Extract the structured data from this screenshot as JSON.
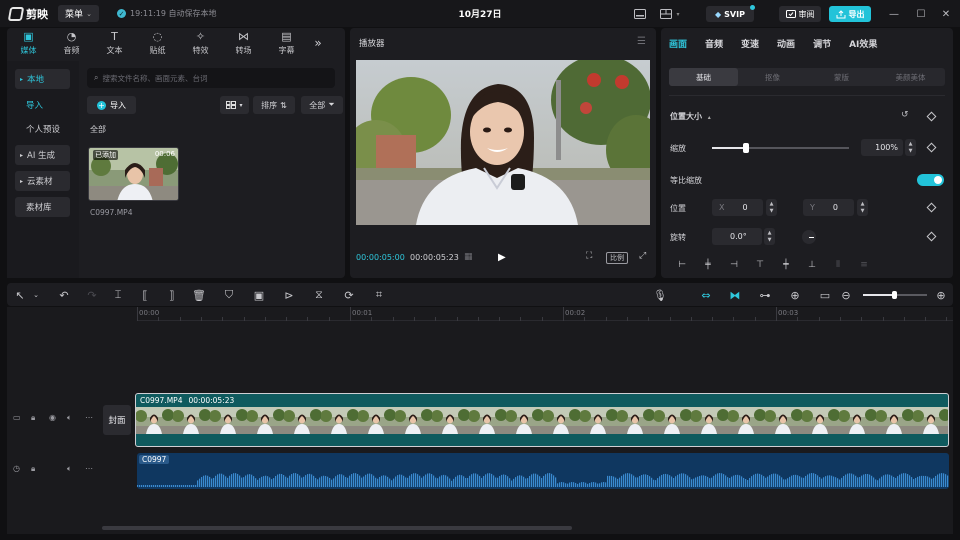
{
  "titlebar": {
    "app_name": "剪映",
    "menu_label": "菜单",
    "save_status": "19:11:19 自动保存本地",
    "project_title": "10月27日",
    "svip_label": "SVIP",
    "review_label": "审阅",
    "export_label": "导出"
  },
  "media_panel": {
    "tabs": [
      {
        "label": "媒体",
        "icon": "media-icon",
        "active": true
      },
      {
        "label": "音频",
        "icon": "audio-icon"
      },
      {
        "label": "文本",
        "icon": "text-icon"
      },
      {
        "label": "贴纸",
        "icon": "sticker-icon"
      },
      {
        "label": "特效",
        "icon": "effects-icon"
      },
      {
        "label": "转场",
        "icon": "transition-icon"
      },
      {
        "label": "字幕",
        "icon": "subtitle-icon"
      }
    ],
    "side_nav": [
      {
        "label": "本地",
        "active": true,
        "boxed": true,
        "arrow": true
      },
      {
        "label": "导入",
        "active": true
      },
      {
        "label": "个人预设"
      },
      {
        "label": "AI 生成",
        "boxed": true,
        "arrow": true
      },
      {
        "label": "云素材",
        "boxed": true,
        "arrow": true
      },
      {
        "label": "素材库",
        "boxed": true
      }
    ],
    "search_placeholder": "搜索文件名称、画面元素、台词",
    "import_label": "导入",
    "sort_label": "排序",
    "filter_label": "全部",
    "section_label": "全部",
    "clip": {
      "badge": "已添加",
      "duration": "00:06",
      "filename": "C0997.MP4"
    }
  },
  "player": {
    "title": "播放器",
    "current_time": "00:00:05:00",
    "total_time": "00:00:05:23",
    "ratio_label": "比例"
  },
  "inspector": {
    "tabs": [
      {
        "label": "画面",
        "active": true
      },
      {
        "label": "音频"
      },
      {
        "label": "变速"
      },
      {
        "label": "动画"
      },
      {
        "label": "调节"
      },
      {
        "label": "AI效果"
      }
    ],
    "subtabs": [
      {
        "label": "基础",
        "active": true
      },
      {
        "label": "抠像"
      },
      {
        "label": "蒙版"
      },
      {
        "label": "美颜美体"
      }
    ],
    "section_title": "位置大小",
    "scale_label": "缩放",
    "scale_value": "100%",
    "scale_fraction": 0.25,
    "uniform_scale_label": "等比缩放",
    "uniform_scale_on": true,
    "position_label": "位置",
    "pos_x_label": "X",
    "pos_x": "0",
    "pos_y_label": "Y",
    "pos_y": "0",
    "rotation_label": "旋转",
    "rotation_value": "0.0°"
  },
  "timeline": {
    "ruler_labels": [
      "00:00",
      "00:01",
      "00:02",
      "00:03"
    ],
    "cover_label": "封面",
    "video_clip_name": "C0997.MP4",
    "video_clip_duration": "00:00:05:23",
    "audio_clip_name": "C0997",
    "zoom_fraction": 0.5
  },
  "colors": {
    "accent": "#22c3d9",
    "video_clip": "#0f5a5e",
    "audio_clip": "#0f3760"
  }
}
